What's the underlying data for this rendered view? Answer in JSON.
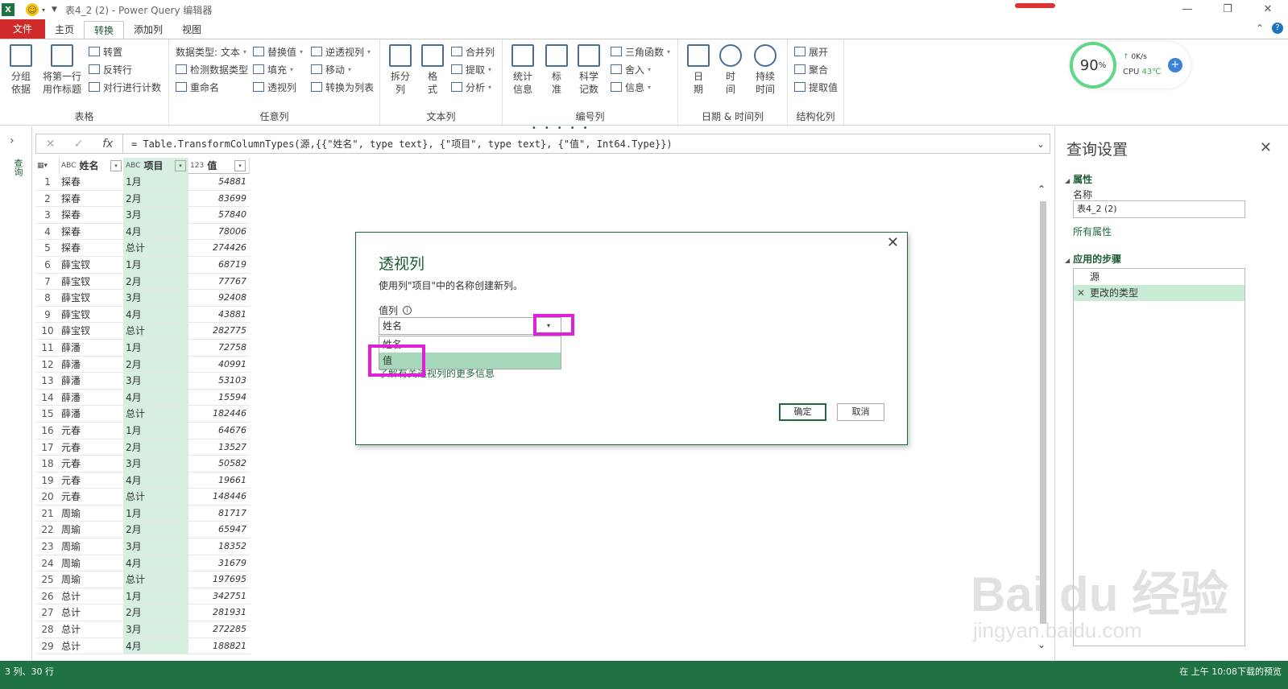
{
  "window": {
    "app_icon": "X",
    "title": "表4_2 (2) - Power Query 编辑器",
    "controls": [
      "—",
      "❐",
      "✕"
    ]
  },
  "tabs": [
    {
      "label": "文件"
    },
    {
      "label": "主页"
    },
    {
      "label": "转换"
    },
    {
      "label": "添加列"
    },
    {
      "label": "视图"
    }
  ],
  "ribbon": {
    "groups": {
      "table": "表格",
      "any_column": "任意列",
      "text_column": "文本列",
      "number_column": "编号列",
      "datetime_column": "日期 & 时间列",
      "structured_column": "结构化列"
    },
    "group_by": "分组\n依据",
    "use_first_row": "将第一行\n用作标题",
    "transpose": "转置",
    "reverse_rows": "反转行",
    "count_rows": "对行进行计数",
    "data_type": "数据类型: 文本",
    "detect_type": "检测数据类型",
    "rename": "重命名",
    "replace_values": "替换值",
    "fill": "填充",
    "pivot": "透视列",
    "unpivot": "逆透视列",
    "move": "移动",
    "to_list": "转换为列表",
    "split": "拆分\n列",
    "format": "格\n式",
    "merge_cols": "合并列",
    "extract": "提取",
    "parse": "分析",
    "statistics": "统计\n信息",
    "standard": "标\n准",
    "scientific": "科学\n记数",
    "trig": "三角函数",
    "rounding": "舍入",
    "information": "信息",
    "date": "日\n期",
    "time": "时\n间",
    "duration": "持续\n时间",
    "expand": "展开",
    "aggregate": "聚合",
    "extract_values": "提取值"
  },
  "cpu_widget": {
    "percent": "90",
    "percent_unit": "%",
    "speed": "0K/s",
    "cpu_label": "CPU",
    "temp": "43℃"
  },
  "leftnav": {
    "label": "查询"
  },
  "formula": "= Table.TransformColumnTypes(源,{{\"姓名\", type text}, {\"项目\", type text}, {\"值\", Int64.Type}})",
  "grid": {
    "headers": [
      {
        "type": "ABC",
        "name": "姓名"
      },
      {
        "type": "ABC",
        "name": "项目"
      },
      {
        "type": "123",
        "name": "值"
      }
    ],
    "rows": [
      [
        "1",
        "探春",
        "1月",
        "54881"
      ],
      [
        "2",
        "探春",
        "2月",
        "83699"
      ],
      [
        "3",
        "探春",
        "3月",
        "57840"
      ],
      [
        "4",
        "探春",
        "4月",
        "78006"
      ],
      [
        "5",
        "探春",
        "总计",
        "274426"
      ],
      [
        "6",
        "薛宝钗",
        "1月",
        "68719"
      ],
      [
        "7",
        "薛宝钗",
        "2月",
        "77767"
      ],
      [
        "8",
        "薛宝钗",
        "3月",
        "92408"
      ],
      [
        "9",
        "薛宝钗",
        "4月",
        "43881"
      ],
      [
        "10",
        "薛宝钗",
        "总计",
        "282775"
      ],
      [
        "11",
        "薛潘",
        "1月",
        "72758"
      ],
      [
        "12",
        "薛潘",
        "2月",
        "40991"
      ],
      [
        "13",
        "薛潘",
        "3月",
        "53103"
      ],
      [
        "14",
        "薛潘",
        "4月",
        "15594"
      ],
      [
        "15",
        "薛潘",
        "总计",
        "182446"
      ],
      [
        "16",
        "元春",
        "1月",
        "64676"
      ],
      [
        "17",
        "元春",
        "2月",
        "13527"
      ],
      [
        "18",
        "元春",
        "3月",
        "50582"
      ],
      [
        "19",
        "元春",
        "4月",
        "19661"
      ],
      [
        "20",
        "元春",
        "总计",
        "148446"
      ],
      [
        "21",
        "周瑜",
        "1月",
        "81717"
      ],
      [
        "22",
        "周瑜",
        "2月",
        "65947"
      ],
      [
        "23",
        "周瑜",
        "3月",
        "18352"
      ],
      [
        "24",
        "周瑜",
        "4月",
        "31679"
      ],
      [
        "25",
        "周瑜",
        "总计",
        "197695"
      ],
      [
        "26",
        "总计",
        "1月",
        "342751"
      ],
      [
        "27",
        "总计",
        "2月",
        "281931"
      ],
      [
        "28",
        "总计",
        "3月",
        "272285"
      ],
      [
        "29",
        "总计",
        "4月",
        "188821"
      ]
    ]
  },
  "query_settings": {
    "title": "查询设置",
    "properties": "属性",
    "name_label": "名称",
    "name_value": "表4_2 (2)",
    "all_props": "所有属性",
    "applied_steps": "应用的步骤",
    "steps": [
      "源",
      "更改的类型"
    ]
  },
  "statusbar": {
    "left": "3 列、30 行",
    "right": "在 上午 10:08下载的预览"
  },
  "watermark": {
    "main": "Bai du 经验",
    "sub": "jingyan.baidu.com"
  },
  "dialog": {
    "title": "透视列",
    "description": "使用列\"项目\"中的名称创建新列。",
    "values_label": "值列",
    "selected": "姓名",
    "options": [
      "姓名",
      "值"
    ],
    "learn_more": "了解有关透视列的更多信息",
    "ok": "确定",
    "cancel": "取消"
  },
  "colors": {
    "accent": "#1f7244",
    "file_tab": "#cf2b2b",
    "highlight": "#e020d8",
    "column_fill": "#d6efe1"
  }
}
